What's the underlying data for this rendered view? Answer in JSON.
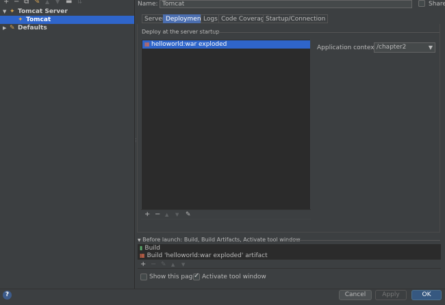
{
  "left_toolbar": {
    "icons": [
      "add-icon",
      "remove-icon",
      "copy-icon",
      "wrench-icon",
      "move-up-icon",
      "move-down-icon",
      "folder-icon",
      "sort-icon"
    ]
  },
  "tree": {
    "items": [
      {
        "label": "Tomcat Server",
        "icon": "tomcat-icon",
        "expanded": true,
        "level": 0,
        "selected": false
      },
      {
        "label": "Tomcat",
        "icon": "tomcat-icon",
        "level": 1,
        "selected": true
      },
      {
        "label": "Defaults",
        "icon": "wrench-icon",
        "expanded": false,
        "level": 0,
        "selected": false
      }
    ]
  },
  "form": {
    "name_label": "Name:",
    "name_value": "Tomcat",
    "share_label": "Share",
    "share_checked": false
  },
  "tabs": [
    {
      "label": "Server",
      "active": false
    },
    {
      "label": "Deployment",
      "active": true
    },
    {
      "label": "Logs",
      "active": false
    },
    {
      "label": "Code Coverage",
      "active": false
    },
    {
      "label": "Startup/Connection",
      "active": false
    }
  ],
  "deployment": {
    "header": "Deploy at the server startup",
    "artifacts": [
      {
        "label": "helloworld:war exploded",
        "icon": "artifact-icon",
        "selected": true
      }
    ],
    "context_label": "Application context:",
    "context_value": "/chapter2"
  },
  "before_launch": {
    "header": "Before launch: Build, Build Artifacts, Activate tool window",
    "items": [
      {
        "label": "Build",
        "icon": "build-icon"
      },
      {
        "label": "Build 'helloworld:war exploded' artifact",
        "icon": "artifact-icon"
      }
    ]
  },
  "options": {
    "show_page_label": "Show this page",
    "show_page_checked": false,
    "activate_tool_label": "Activate tool window",
    "activate_tool_checked": true
  },
  "buttons": {
    "help": "?",
    "cancel": "Cancel",
    "apply": "Apply",
    "ok": "OK"
  },
  "colors": {
    "background": "#3c3f41",
    "selection": "#2f65ca",
    "active_tab": "#4b6eaf",
    "primary_button": "#365880"
  }
}
